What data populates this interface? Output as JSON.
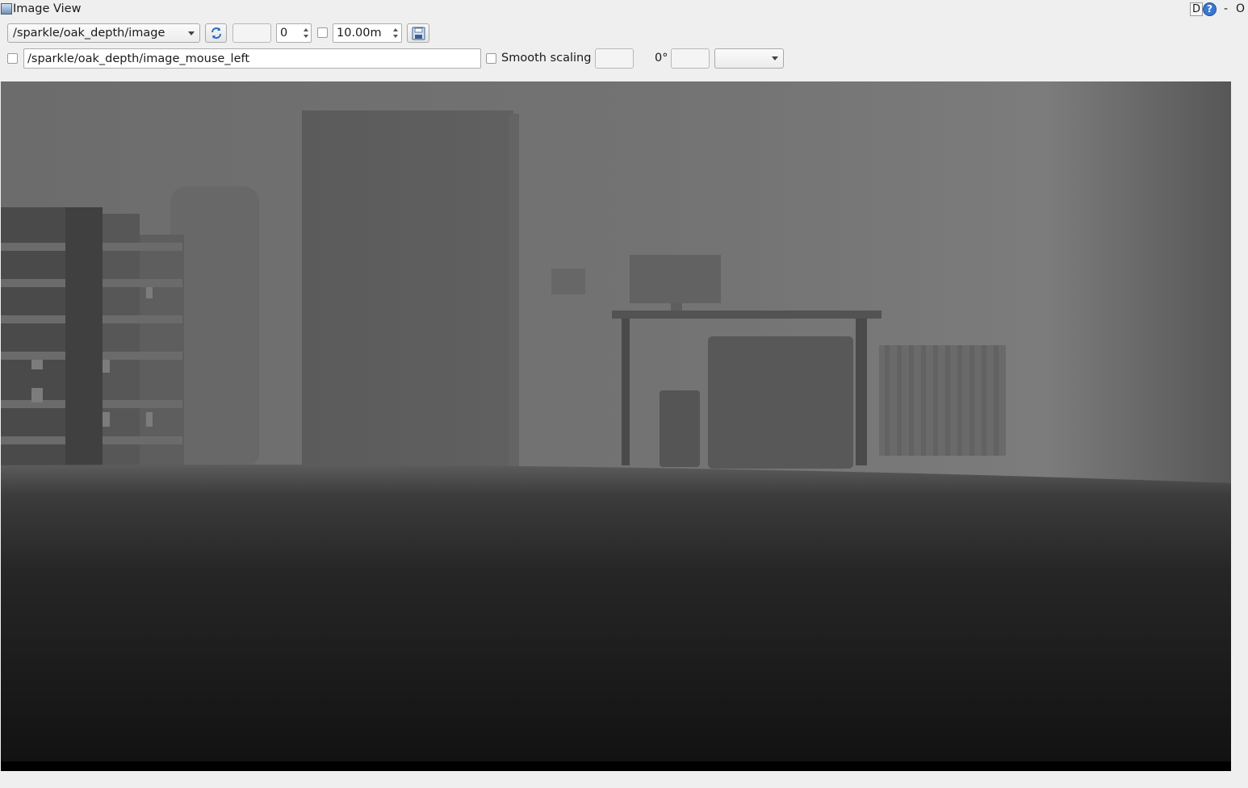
{
  "window": {
    "title": "Image View",
    "d_label": "D",
    "help_label": "?",
    "dash_label": "-",
    "close_label": "O"
  },
  "toolbar": {
    "topic": "/sparkle/oak_depth/image",
    "min_value": "",
    "spin_value": "0",
    "max_depth": "10.00m"
  },
  "toolbar2": {
    "mouse_topic": "/sparkle/oak_depth/image_mouse_left",
    "smooth_scaling_label": "Smooth scaling",
    "rotation_label": "0°"
  },
  "image": {
    "content": "depth-image-grayscale"
  }
}
